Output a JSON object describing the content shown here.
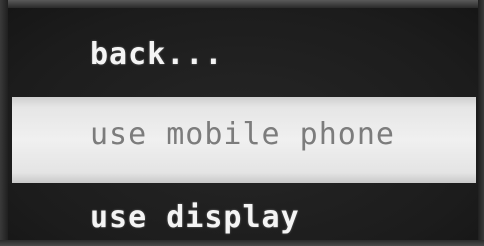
{
  "menu": {
    "items": [
      {
        "label": "back...",
        "selected": false
      },
      {
        "label": "use mobile phone",
        "selected": true
      },
      {
        "label": "use display",
        "selected": false
      }
    ]
  },
  "colors": {
    "background": "#1f1f1f",
    "text": "#f4f4f4",
    "highlight": "#f0f0f0",
    "highlight_text": "#7c7c7c"
  }
}
